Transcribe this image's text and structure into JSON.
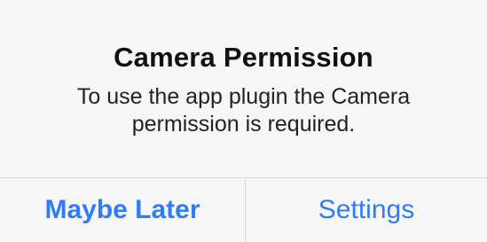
{
  "dialog": {
    "title": "Camera Permission",
    "message_lines": [
      "To use the app plugin the Camera",
      "permission is required."
    ],
    "buttons": {
      "maybe_later": "Maybe Later",
      "settings": "Settings"
    }
  },
  "colors": {
    "background": "#f6f6f6",
    "accent": "#2f7cf6",
    "divider": "#d9d9d9"
  }
}
